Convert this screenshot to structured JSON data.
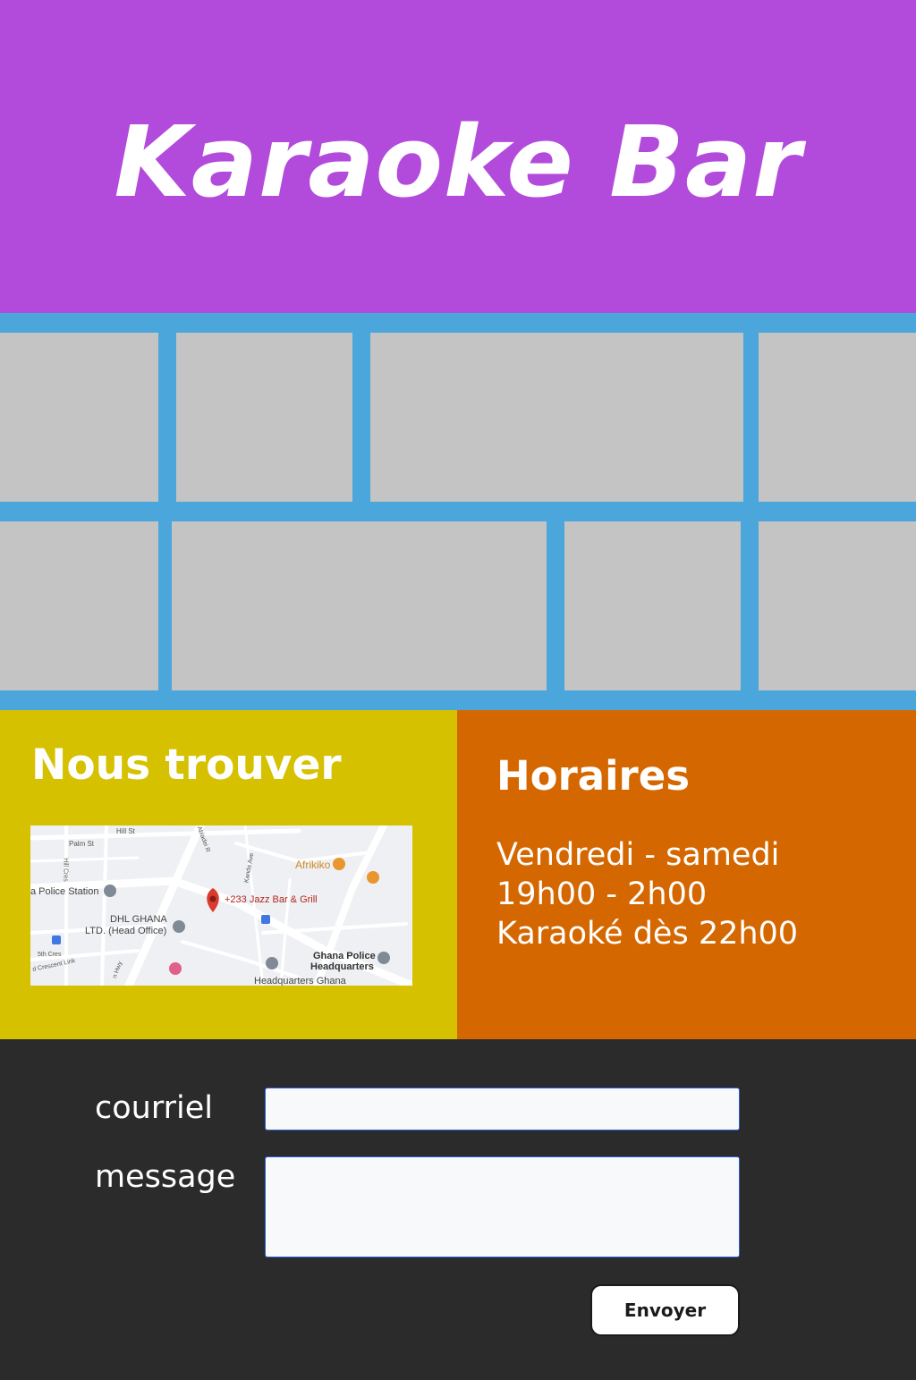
{
  "header": {
    "title": "Karaoke Bar"
  },
  "colors": {
    "header_bg": "#b24bdb",
    "gallery_bg": "#4ba6dc",
    "photo_placeholder": "#c4c4c4",
    "find_us_bg": "#d6c100",
    "hours_bg": "#d56700",
    "contact_bg": "#2b2b2b"
  },
  "find_us": {
    "title": "Nous trouver",
    "map": {
      "labels": {
        "hill_st": "Hill St",
        "palm_st": "Palm St",
        "hill_cres": "Hill Cres",
        "abladei": "Abladei R",
        "kanda_ave": "Kanda Ave",
        "afrikiko": "Afrikiko",
        "police_station": "a Police Station",
        "jazz_bar": "+233 Jazz Bar & Grill",
        "dhl_1": "DHL GHANA",
        "dhl_2": "LTD. (Head Office)",
        "fifth_cres": "5th Cres",
        "crescent_link": "d Crescent Link",
        "hwy": "n Hwy",
        "ghana_police_1": "Ghana Police",
        "ghana_police_2": "Headquarters",
        "hq_ghana": "Headquarters Ghana"
      }
    }
  },
  "hours": {
    "title": "Horaires",
    "lines": [
      "Vendredi - samedi",
      "19h00 - 2h00",
      "Karaoké dès 22h00"
    ]
  },
  "contact": {
    "email_label": "courriel",
    "message_label": "message",
    "email_value": "",
    "message_value": "",
    "submit_label": "Envoyer"
  }
}
